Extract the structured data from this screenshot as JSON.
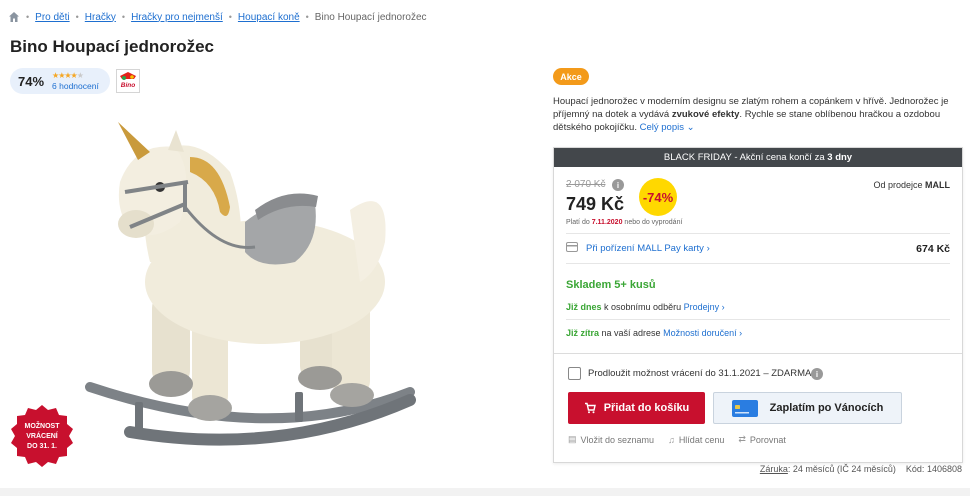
{
  "breadcrumb": {
    "items": [
      "Pro děti",
      "Hračky",
      "Hračky pro nejmenší",
      "Houpací koně"
    ],
    "current": "Bino Houpací jednorožec"
  },
  "product": {
    "title": "Bino Houpací jednorožec",
    "rating_percent": "74%",
    "rating_stars": 3.5,
    "rating_count": "6 hodnocení",
    "brand_logo_text": "Bino",
    "return_badge": [
      "MOŽNOST",
      "VRÁCENÍ",
      "DO 31. 1."
    ]
  },
  "promo": {
    "label": "Akce",
    "description_1": "Houpací jednorožec v moderním designu se zlatým rohem a copánkem v hřívě. Jednorožec je příjemný na dotek a vydává ",
    "description_bold": "zvukové efekty",
    "description_2": ". Rychle se stane oblíbenou hračkou a ozdobou dětského pokojíčku.",
    "more_link": "Celý popis"
  },
  "offer": {
    "bf_text": "BLACK FRIDAY - Akční cena končí za ",
    "bf_bold": "3 dny",
    "old_price": "2 070 Kč",
    "price": "749 Kč",
    "discount": "-74%",
    "seller_prefix": "Od prodejce",
    "seller_name": "MALL",
    "valid_prefix": "Platí do",
    "valid_date": "7.11.2020",
    "valid_suffix": "nebo do vyprodání",
    "mallpay_label": "Při pořízení MALL Pay karty",
    "mallpay_price": "674 Kč",
    "stock": "Skladem 5+ kusů",
    "pickup_green": "Již dnes",
    "pickup_text": "k osobnímu odběru",
    "pickup_link": "Prodejny",
    "delivery_green": "Již zítra",
    "delivery_text": "na vaší adrese",
    "delivery_link": "Možnosti doručení",
    "extend_return": "Prodloužit možnost vrácení do 31.1.2021 – ZDARMA",
    "add_to_cart": "Přidat do košíku",
    "pay_xmas": "Zaplatím po Vánocích",
    "wishlist": "Vložit do seznamu",
    "watch_price": "Hlídat cenu",
    "compare": "Porovnat"
  },
  "footer": {
    "warranty_label": "Záruka",
    "warranty_text": ": 24 měsíců (IČ 24 měsíců)",
    "code_label": "Kód:",
    "code_value": "1406808"
  },
  "colors": {
    "link": "#1e6fd0",
    "red": "#c8102e",
    "green": "#3aa635",
    "orange": "#f39a1a",
    "yellow": "#ffd800",
    "dark_bar": "#43474b"
  }
}
